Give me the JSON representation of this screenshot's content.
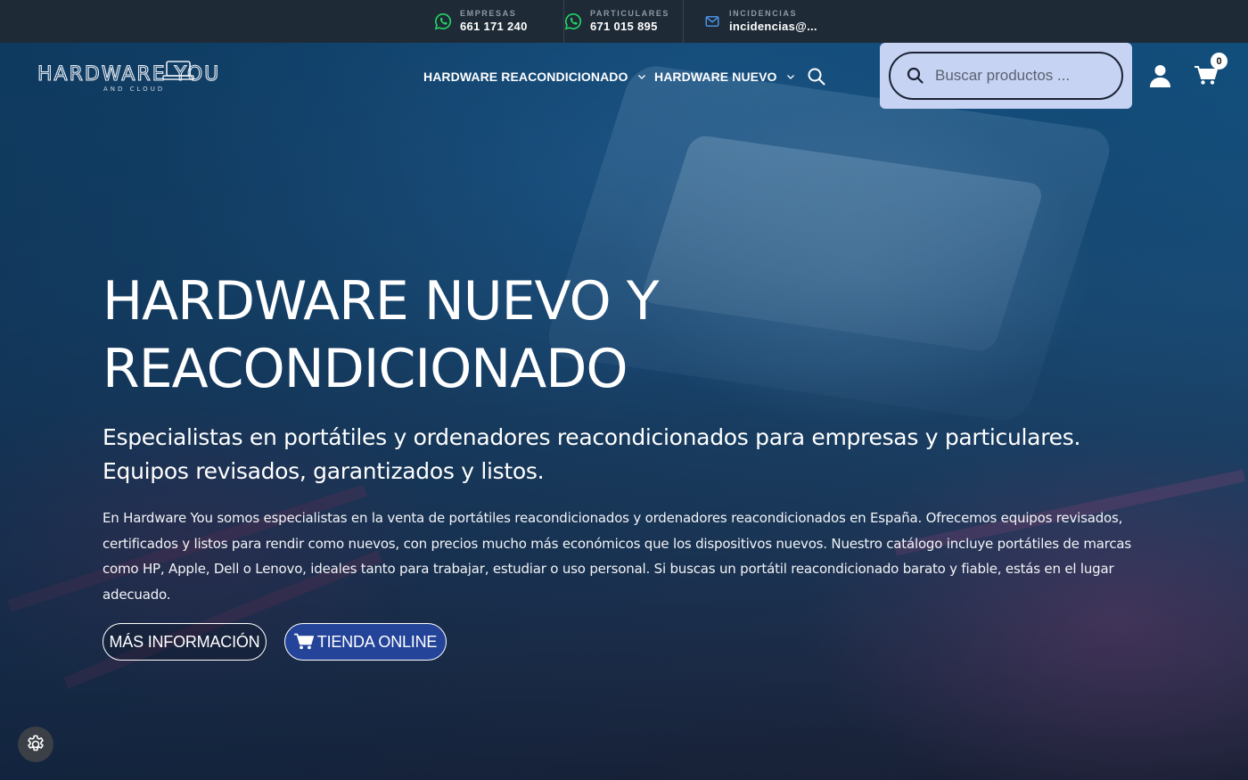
{
  "topbar": {
    "contacts": [
      {
        "label": "EMPRESAS",
        "value": "661 171 240",
        "icon": "whatsapp-icon"
      },
      {
        "label": "PARTICULARES",
        "value": "671 015 895",
        "icon": "whatsapp-icon"
      },
      {
        "label": "INCIDENCIAS",
        "value": "incidencias@...",
        "icon": "mail-icon"
      }
    ],
    "whatsapp_color": "#25d366",
    "mail_color": "#4a90e2"
  },
  "header": {
    "logo_text": "HARDWARE YOU",
    "logo_subtext": "AND CLOUD",
    "nav": [
      {
        "label": "HARDWARE REACONDICIONADO"
      },
      {
        "label": "HARDWARE NUEVO"
      }
    ],
    "search": {
      "placeholder": "Buscar productos ..."
    },
    "cart_count": "0"
  },
  "hero": {
    "title_line1": "HARDWARE NUEVO Y",
    "title_line2": "REACONDICIONADO",
    "subtitle": "Especialistas en portátiles y ordenadores reacondicionados para empresas y particulares. Equipos revisados, garantizados y listos.",
    "description": "En Hardware You somos especialistas en la venta de portátiles reacondicionados y ordenadores reacondicionados en España. Ofrecemos equipos revisados, certificados y listos para rendir como nuevos, con precios mucho más económicos que los dispositivos nuevos. Nuestro catálogo incluye portátiles de marcas como HP, Apple, Dell o Lenovo, ideales tanto para trabajar, estudiar o uso personal. Si buscas un portátil reacondicionado barato y fiable, estás en el lugar adecuado.",
    "button_info": "MÁS INFORMACIÓN",
    "button_shop": "TIENDA ONLINE",
    "accent_color": "#24449a"
  }
}
